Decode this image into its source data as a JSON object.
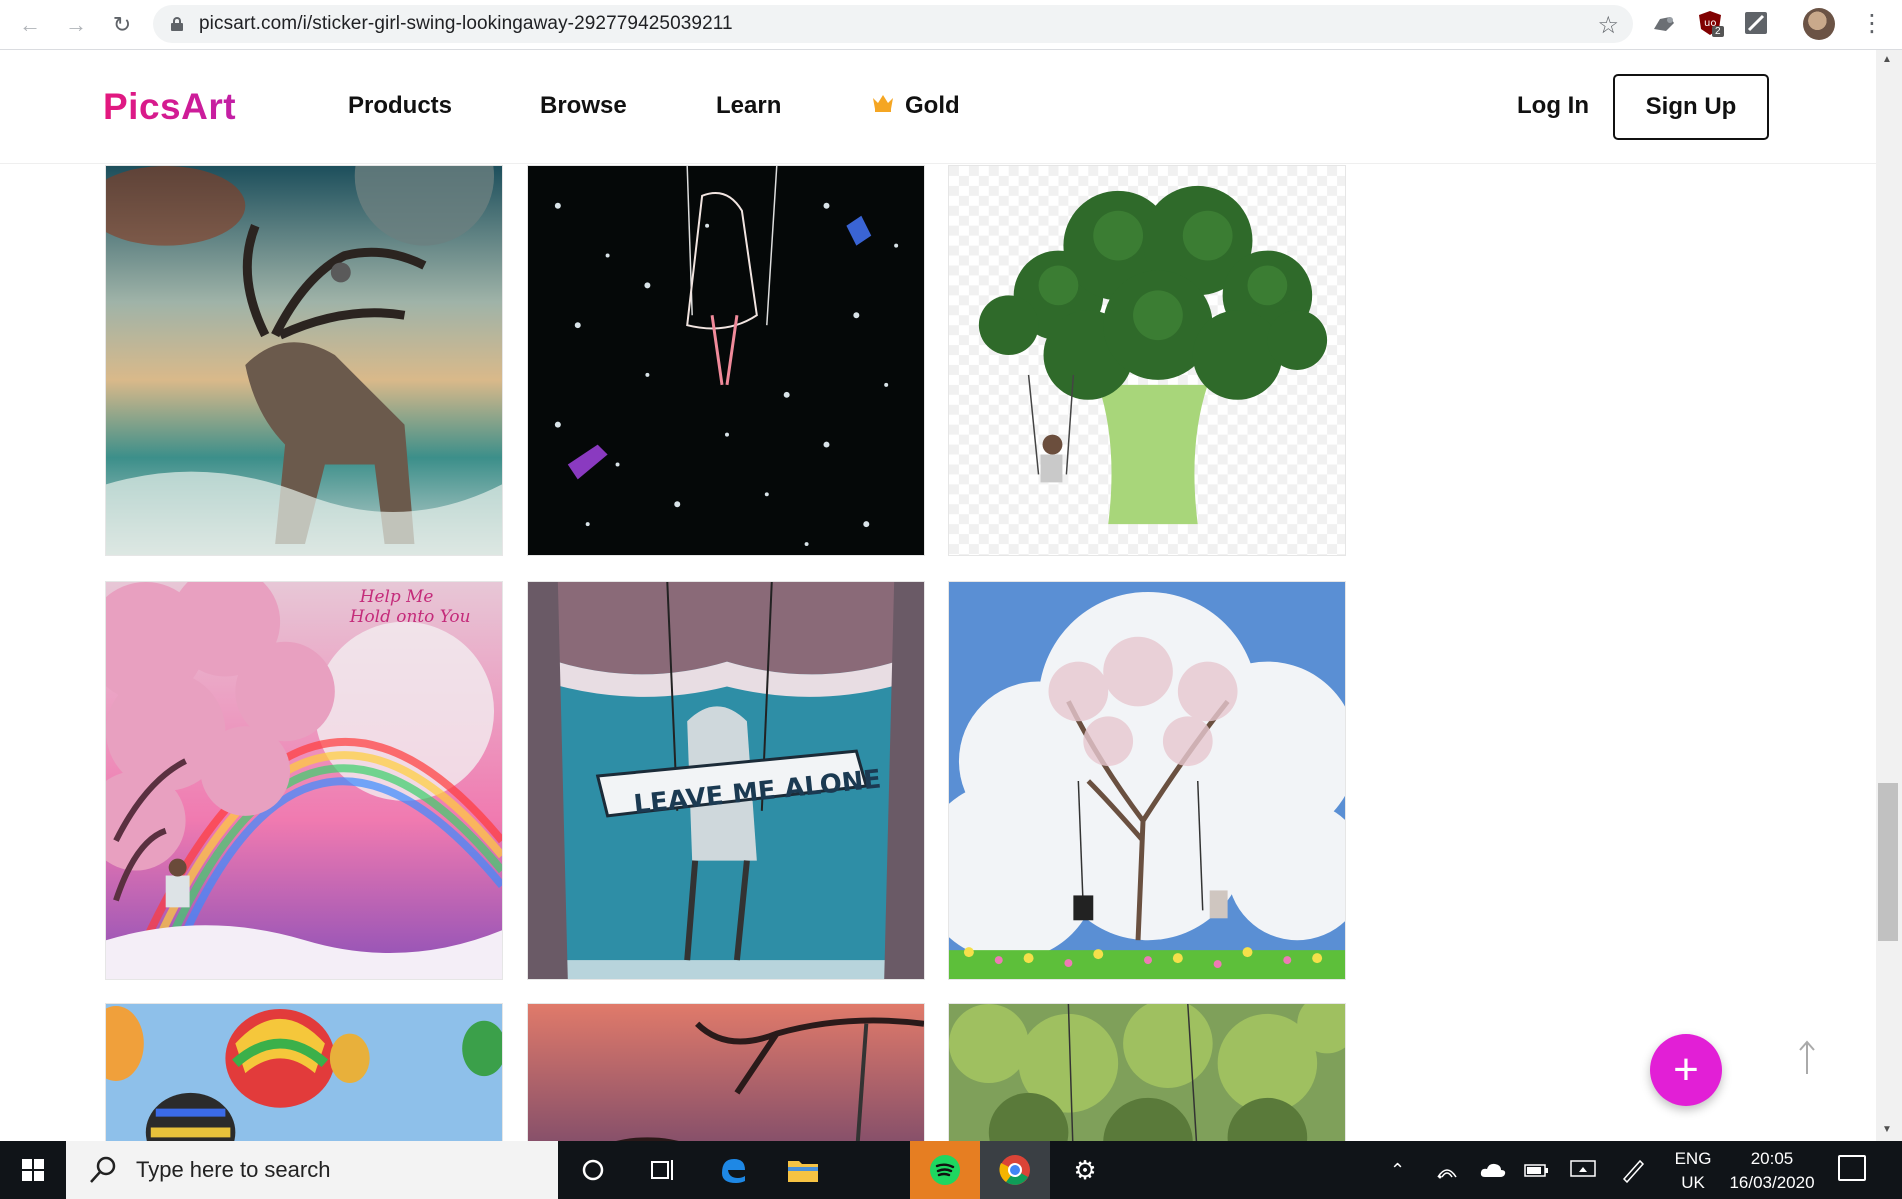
{
  "browser": {
    "url": "picsart.com/i/sticker-girl-swing-lookingaway-292779425039211"
  },
  "site": {
    "logo": "PicsArt",
    "nav": [
      "Products",
      "Browse",
      "Learn",
      "Gold"
    ],
    "login": "Log In",
    "signup": "Sign Up"
  },
  "tiles": [
    {
      "name": "deer-owl-planet-art"
    },
    {
      "name": "neon-girl-swing-night"
    },
    {
      "name": "broccoli-tree-swing"
    },
    {
      "name": "cherry-blossom-rainbow",
      "caption": "Help Me Hold onto You"
    },
    {
      "name": "leave-me-alone-swing",
      "banner": "LEAVE ME ALONE"
    },
    {
      "name": "blossom-tree-couple-swings"
    },
    {
      "name": "hot-air-balloons"
    },
    {
      "name": "sunset-branch-swing"
    },
    {
      "name": "forest-swing"
    }
  ],
  "fab": {
    "label": "+"
  },
  "taskbar": {
    "search_placeholder": "Type here to search",
    "lang_top": "ENG",
    "lang_bottom": "UK",
    "time": "20:05",
    "date": "16/03/2020"
  },
  "extensions": {
    "badge": "2"
  }
}
